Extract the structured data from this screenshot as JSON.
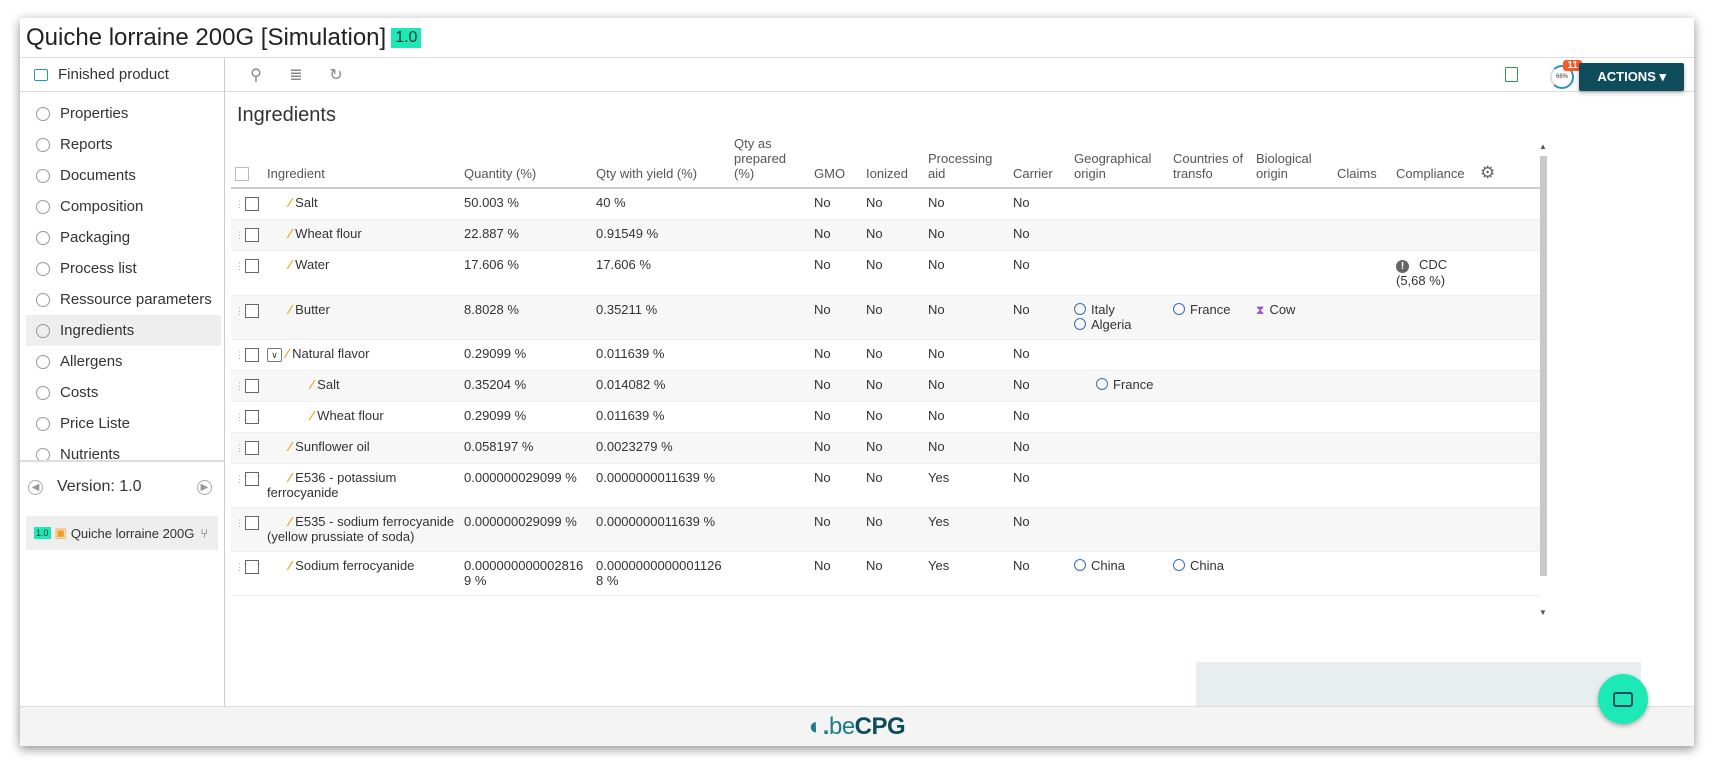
{
  "window": {
    "title": "Quiche lorraine 200G [Simulation]",
    "version_badge": "1.0"
  },
  "sidebar": {
    "header": "Finished product",
    "items": [
      {
        "label": "Properties"
      },
      {
        "label": "Reports"
      },
      {
        "label": "Documents"
      },
      {
        "label": "Composition"
      },
      {
        "label": "Packaging"
      },
      {
        "label": "Process list"
      },
      {
        "label": "Ressource parameters"
      },
      {
        "label": "Ingredients"
      },
      {
        "label": "Allergens"
      },
      {
        "label": "Costs"
      },
      {
        "label": "Price Liste"
      },
      {
        "label": "Nutrients"
      }
    ],
    "active_item": "Ingredients",
    "version_label": "Version: 1.0",
    "version_item": {
      "badge": "1.0",
      "name": "Quiche lorraine 200G"
    }
  },
  "toolbar": {
    "actions_label": "ACTIONS ▾",
    "progress_label": "66%",
    "notification_count": "11"
  },
  "section": {
    "title": "Ingredients"
  },
  "table": {
    "headers": {
      "ingredient": "Ingredient",
      "quantity": "Quantity (%)",
      "qty_yield": "Qty with yield (%)",
      "qty_prepared": "Qty as prepared (%)",
      "gmo": "GMO",
      "ionized": "Ionized",
      "processing_aid": "Processing aid",
      "carrier": "Carrier",
      "geo_origin": "Geographical origin",
      "countries_transfo": "Countries of transfo",
      "bio_origin": "Biological origin",
      "claims": "Claims",
      "compliance": "Compliance"
    },
    "rows": [
      {
        "name": "Salt",
        "qty": "50.003 %",
        "qty_yield": "40 %",
        "gmo": "No",
        "ionized": "No",
        "aid": "No",
        "carrier": "No",
        "geo": [],
        "transfo": [],
        "bio": "",
        "compliance": ""
      },
      {
        "name": "Wheat flour",
        "qty": "22.887 %",
        "qty_yield": "0.91549 %",
        "gmo": "No",
        "ionized": "No",
        "aid": "No",
        "carrier": "No",
        "geo": [],
        "transfo": [],
        "bio": "",
        "compliance": ""
      },
      {
        "name": "Water",
        "qty": "17.606 %",
        "qty_yield": "17.606 %",
        "gmo": "No",
        "ionized": "No",
        "aid": "No",
        "carrier": "No",
        "geo": [],
        "transfo": [],
        "bio": "",
        "compliance": "CDC",
        "compliance_sub": "(5,68 %)"
      },
      {
        "name": "Butter",
        "qty": "8.8028 %",
        "qty_yield": "0.35211 %",
        "gmo": "No",
        "ionized": "No",
        "aid": "No",
        "carrier": "No",
        "geo": [
          "Italy",
          "Algeria"
        ],
        "transfo": [
          "France"
        ],
        "bio": "Cow",
        "compliance": ""
      },
      {
        "name": "Natural flavor",
        "qty": "0.29099 %",
        "qty_yield": "0.011639 %",
        "gmo": "No",
        "ionized": "No",
        "aid": "No",
        "carrier": "No",
        "geo": [],
        "transfo": [],
        "bio": "",
        "compliance": ""
      },
      {
        "name": "Salt",
        "qty": "0.35204 %",
        "qty_yield": "0.014082 %",
        "gmo": "No",
        "ionized": "No",
        "aid": "No",
        "carrier": "No",
        "geo": [
          "France"
        ],
        "transfo": [],
        "bio": "",
        "compliance": ""
      },
      {
        "name": "Wheat flour",
        "qty": "0.29099 %",
        "qty_yield": "0.011639 %",
        "gmo": "No",
        "ionized": "No",
        "aid": "No",
        "carrier": "No",
        "geo": [],
        "transfo": [],
        "bio": "",
        "compliance": ""
      },
      {
        "name": "Sunflower oil",
        "qty": "0.058197 %",
        "qty_yield": "0.0023279 %",
        "gmo": "No",
        "ionized": "No",
        "aid": "No",
        "carrier": "No",
        "geo": [],
        "transfo": [],
        "bio": "",
        "compliance": ""
      },
      {
        "name": "E536 - potassium ferrocyanide",
        "qty": "0.000000029099 %",
        "qty_yield": "0.0000000011639 %",
        "gmo": "No",
        "ionized": "No",
        "aid": "Yes",
        "carrier": "No",
        "geo": [],
        "transfo": [],
        "bio": "",
        "compliance": ""
      },
      {
        "name": "E535 - sodium ferrocyanide (yellow prussiate of soda)",
        "qty": "0.000000029099 %",
        "qty_yield": "0.0000000011639 %",
        "gmo": "No",
        "ionized": "No",
        "aid": "Yes",
        "carrier": "No",
        "geo": [],
        "transfo": [],
        "bio": "",
        "compliance": ""
      },
      {
        "name": "Sodium ferrocyanide",
        "qty": "0.0000000000028169 %",
        "qty_yield": "0.00000000000011268 %",
        "gmo": "No",
        "ionized": "No",
        "aid": "Yes",
        "carrier": "No",
        "geo": [
          "China"
        ],
        "transfo": [
          "China"
        ],
        "bio": "",
        "compliance": ""
      }
    ]
  },
  "footer": {
    "logo_prefix": "be",
    "logo_main": "CPG"
  }
}
